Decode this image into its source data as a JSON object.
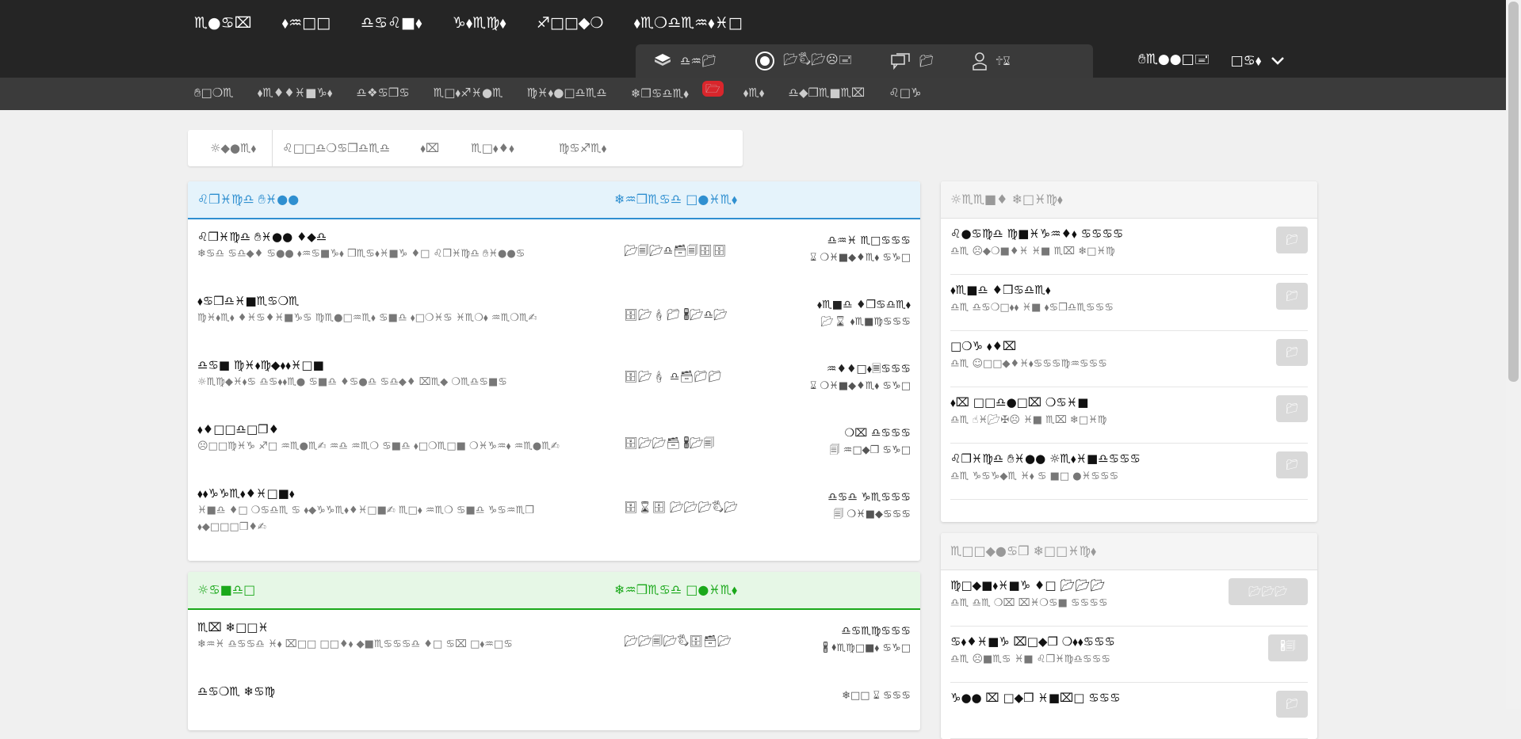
{
  "header": {
    "main_nav": [
      "♏︎●♋︎⌧︎",
      "⬧︎♒︎□︎□︎",
      "♎︎♋︎♌︎■︎⬧︎",
      "♑︎⬧︎♏︎♍︎⬧︎",
      "♐︎□︎□︎◆︎❍︎",
      "⬧︎♏︎❍︎♎︎♏︎♒︎⬧︎♓︎□︎"
    ],
    "tools": [
      {
        "icon": "cube-icon",
        "label": "♎︎♒︎📁︎"
      },
      {
        "icon": "record-icon",
        "label": "📂︎🖏︎📂︎☹︎🖃︎"
      },
      {
        "icon": "chat-icon",
        "label": "📁︎"
      },
      {
        "icon": "user-icon",
        "label": "🕆︎⌛︎"
      }
    ],
    "user_name": "✋︎♏︎●●□︎🖃︎",
    "user_menu": "□︎♋︎⬧︎"
  },
  "subnav": [
    "✋︎□︎❍︎♏︎",
    "⬧︎♏︎♦︎♦︎♓︎■︎♑︎⬧︎",
    "♎︎❖︎♋︎❒︎♋︎",
    "♏︎□︎⬧︎♐︎♓︎●︎♏︎",
    "♍︎♓︎⬧︎●︎□︎♎︎♏︎♎︎",
    "❄︎❒︎♋︎♎︎♏︎⬧︎",
    "⬧︎♏︎⬧︎",
    "♎︎◆︎❒︎♏︎■︎♏︎⌧︎",
    "♌︎□︎♑︎"
  ],
  "subnav_badge": "🗁︎",
  "filter_tabs": [
    "☼︎◆︎●︎♏︎⬧︎",
    "♌︎□︎□︎♎︎❍︎♋︎❒︎♎︎♏︎♎︎",
    "⬧︎⌧︎",
    "♏︎□︎⬧︎♦︎⬧︎",
    "♍︎♋︎♐︎♏︎⬧︎"
  ],
  "blue_card": {
    "title": "♌︎❒︎♓︎♍︎♎︎ ✋︎♓︎●●",
    "right": "❄︎♒︎❒︎♏︎♋︎♎︎ □︎●♓︎♏︎⬧︎",
    "rows": [
      {
        "title": "♌︎❒︎♓︎♍︎♎︎ ✋︎♓︎●● ♦︎◆︎♎︎",
        "desc": "❄︎♋︎♎︎ ♋︎♎︎◆︎♦︎ ♋︎●● ⬧︎♒︎♋︎■︎♑︎⬧︎ ❒︎♏︎♋︎⬧︎♓︎■︎♑︎ ♦︎□︎ ♌︎❒︎♓︎♍︎♎︎ ✋︎♓︎●●♋︎",
        "mid": "📂︎🗐︎📂︎♎︎🗃︎🗐︎🗄︎🗄︎",
        "when_a": "♎︎♒︎♓︎ ♏︎□︎♋︎♋︎♋︎",
        "when_b": "⌛︎ ❍︎♓︎■︎◆︎♦︎♏︎⬧︎ ♋︎♑︎□︎"
      },
      {
        "title": "⬧︎♋︎❒︎♎︎♓︎■︎♏︎♋︎❍︎♏︎",
        "desc": "♍︎♓︎⬧︎♏︎⬧︎ ♦︎♓︎♋︎♦︎♓︎■︎♑︎♋︎ ♍︎♏︎●□︎♒︎♏︎⬧︎ ♋︎■︎♎︎ ⬧︎□︎❍︎♓︎♋︎ ♓︎♏︎❍︎⬧︎ ♒︎♏︎❍︎♏︎✍︎",
        "mid": "🗄︎📂︎🕯︎📁︎ 🖁︎📂︎♎︎📂︎",
        "when_a": "⬧︎♏︎■︎♎︎ ♦︎❒︎♋︎♎︎♏︎⬧︎",
        "when_b": "📂︎⌛︎ ⬧︎♏︎■︎♍︎♋︎♋︎♋︎"
      },
      {
        "title": "♎︎♋︎■︎ ♍︎♓︎⬧︎♍︎◆︎⬧︎⬧︎♓︎□︎■︎",
        "desc": "☼︎♏︎♍︎◆︎♓︎⬧︎♋︎ ♎︎♋︎⬧︎⬧︎♏︎● ♋︎■︎♎︎ ♦︎♋︎●♎︎ ♋︎♎︎◆︎♦︎ ⌧︎♏︎◆︎ ❍︎♏︎♎︎♋︎■︎♋︎",
        "mid": "🗄︎📂︎🕯︎ ♎︎🗃︎📁︎📁︎",
        "when_a": "♒︎♦︎♦︎□︎⬧︎🗏︎♋︎♋︎♋︎",
        "when_b": "⌛︎ ❍︎♓︎■︎◆︎♦︎♏︎⬧︎ ♋︎♑︎□︎"
      },
      {
        "title": "⬧︎♦︎□︎□︎♎︎□︎❒︎♦︎",
        "desc": "☹︎□︎□︎♍︎♓︎♑︎ ♐︎□︎ ♒︎♏︎●♏︎✍︎ ♒︎♎︎ ♒︎♏︎❍︎ ♋︎■︎♎︎ ⬧︎□︎❍︎♏︎□︎■︎ ❍︎♓︎♑︎♒︎⬧︎ ♒︎♏︎●♏︎✍︎",
        "mid": "🗄︎📂︎📂︎🗃︎ 🖁︎📂︎🗐︎",
        "when_a": "❍︎⌧︎ ♎︎♋︎♋︎♋︎",
        "when_b": "🗐︎ ♒︎□︎◆︎❒︎ ♋︎♑︎□︎"
      },
      {
        "title": "⬧︎⬧︎♑︎♑︎♏︎⬧︎♦︎♓︎□︎■︎⬧︎",
        "desc": "♓︎■︎♎︎ ♦︎□︎ ❍︎♋︎♎︎♏︎ ♋︎ ⬧︎◆︎♑︎♑︎♏︎⬧︎♦︎♓︎□︎■︎✍︎ ♏︎□︎⬧︎ ♒︎♏︎❍︎ ♋︎■︎♎︎ ♑︎♋︎♒︎♏︎❒︎ ⬧︎◆︎□︎□︎□︎❒︎♦︎✍︎",
        "mid": "🗄︎⌛︎🗄︎ 📂︎📂︎📂︎🖏︎📂︎",
        "when_a": "♎︎♋︎♎︎ ♑︎♏︎♋︎♋︎♋︎",
        "when_b": "🗐︎ ❍︎♓︎■︎◆︎♋︎♋︎♋︎"
      }
    ]
  },
  "green_card": {
    "title": "☼︎♋︎■︎♎︎□︎",
    "right": "❄︎♒︎❒︎♏︎♋︎♎︎ □︎●♓︎♏︎⬧︎",
    "rows": [
      {
        "title": "♏︎⌧︎ ❄︎□︎□︎♓︎",
        "desc": "❄︎♒︎♓︎ ♎︎♋︎♋︎♎︎ ♓︎⬧︎ ⌧︎□︎□︎ □︎□︎♦︎⬧︎ ◆︎■︎♏︎♋︎♋︎♋︎♎︎ ♦︎□︎ ♋︎⌧︎ □︎⬧︎♒︎□︎♋︎",
        "mid": "📂︎📂︎🗐︎📂︎🖏︎🗄︎🗃︎📂︎",
        "when_a": "♎︎♋︎♏︎♍︎♋︎♋︎♋︎",
        "when_b": "🖁︎ ⬧︎♏︎♍︎□︎■︎⬧︎ ♋︎♑︎□︎"
      },
      {
        "title": "♎︎♋︎❍︎♏︎ ❄︎♋︎♍︎",
        "desc": "",
        "mid": "",
        "when_a": "❄︎□︎□︎ ⌛︎ ♋︎♋︎♋︎",
        "when_b": ""
      }
    ]
  },
  "sidebar_one": {
    "title": "☼︎♏︎♏︎■︎♦︎ ❄︎□︎♓︎♍︎⬧︎",
    "rows": [
      {
        "title": "♌︎●♋︎♍︎♎︎ ♍︎■︎♓︎♑︎♒︎♦︎⬧︎ ♋︎♋︎♋︎♋︎",
        "desc": "♎︎♏︎ ☹︎◆︎❍︎■︎♦︎♓︎ ♓︎■︎ ♏︎⌧︎ ❄︎□︎♓︎♍︎",
        "btn": "📁︎"
      },
      {
        "title": "⬧︎♏︎■︎♎︎ ♦︎❒︎♋︎♎︎♏︎⬧︎",
        "desc": "♎︎♏︎ ♎︎♋︎❍︎□︎⬧︎⬧︎ ♓︎■︎ ⬧︎♋︎❒︎♎︎♏︎♋︎♋︎♋︎",
        "btn": "📁︎"
      },
      {
        "title": "□︎❍︎♑︎ ⬧︎♦︎⌧︎",
        "desc": "♎︎♏︎ ☺︎□︎□︎◆︎♦︎♓︎⬧︎♋︎♋︎♋︎♍︎♒︎♋︎♋︎♋︎",
        "btn": "📁︎"
      },
      {
        "title": "⬧︎⌧︎ □︎□︎♎︎●□︎⌧︎ ❍︎♋︎♓︎■︎",
        "desc": "♎︎♏︎ ☝︎♓︎📂︎✠︎☹︎ ♓︎■︎ ♏︎⌧︎ ❄︎□︎♓︎♍︎",
        "btn": "📁︎"
      },
      {
        "title": "♌︎❒︎♓︎♍︎♎︎ ✋︎♓︎●● ☼︎♏︎⬧︎♓︎■︎♎︎♋︎♋︎♋︎",
        "desc": "♎︎♏︎ ♑︎♋︎♑︎◆︎♏︎ ♓︎⬧︎ ♋︎ ■︎□︎ ●♓︎♋︎♋︎♋︎",
        "btn": "📁︎"
      }
    ]
  },
  "sidebar_two": {
    "title": "♏︎□︎□︎◆︎●♋︎❒︎ ❄︎□︎□︎♓︎♍︎⬧︎",
    "rows": [
      {
        "title": "♍︎□︎◆︎■︎⬧︎♓︎■︎♑︎ ♦︎□︎ 📂︎📂︎📂︎",
        "desc": "♎︎♏︎ ♎︎♏︎ ❍︎⌧︎ ⌧︎♓︎❍︎♋︎■︎ ♋︎♋︎♋︎♋︎",
        "btn": "📂︎📂︎📂︎"
      },
      {
        "title": "♋︎⬧︎♦︎♓︎■︎♑︎ ⌧︎□︎◆︎❒︎ ❍︎⬧︎⬧︎♋︎♋︎♋︎",
        "desc": "♎︎♏︎ ☹︎■︎♏︎♋︎ ♓︎■︎ ♌︎❒︎♓︎♍︎♎︎♋︎♋︎♋︎",
        "btn": "🖁︎🗐︎"
      },
      {
        "title": "♑︎●● ⌧︎ □︎◆︎❒︎ ♓︎■︎⌧︎□︎ ♋︎♋︎♋︎",
        "desc": "",
        "btn": "📁︎"
      }
    ]
  }
}
